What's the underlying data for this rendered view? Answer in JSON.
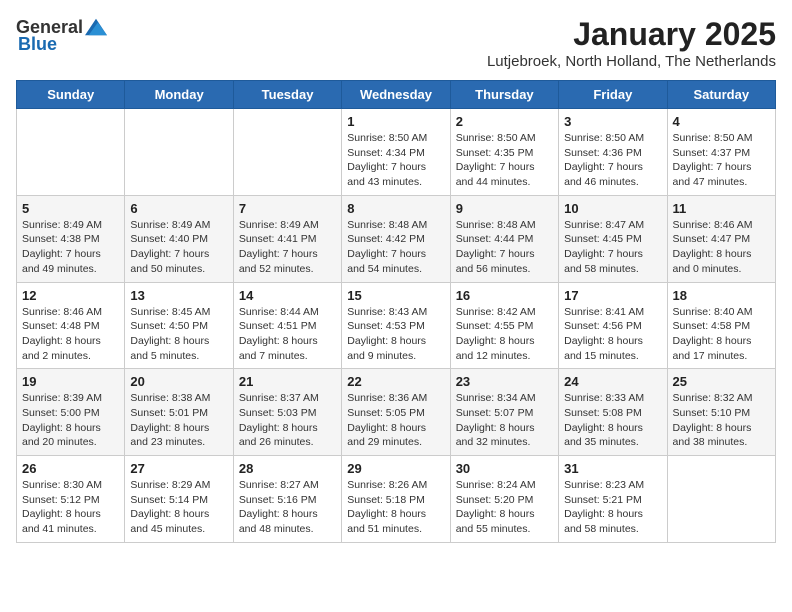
{
  "header": {
    "logo_general": "General",
    "logo_blue": "Blue",
    "month": "January 2025",
    "location": "Lutjebroek, North Holland, The Netherlands"
  },
  "weekdays": [
    "Sunday",
    "Monday",
    "Tuesday",
    "Wednesday",
    "Thursday",
    "Friday",
    "Saturday"
  ],
  "weeks": [
    [
      {
        "day": "",
        "sunrise": "",
        "sunset": "",
        "daylight": ""
      },
      {
        "day": "",
        "sunrise": "",
        "sunset": "",
        "daylight": ""
      },
      {
        "day": "",
        "sunrise": "",
        "sunset": "",
        "daylight": ""
      },
      {
        "day": "1",
        "sunrise": "Sunrise: 8:50 AM",
        "sunset": "Sunset: 4:34 PM",
        "daylight": "Daylight: 7 hours and 43 minutes."
      },
      {
        "day": "2",
        "sunrise": "Sunrise: 8:50 AM",
        "sunset": "Sunset: 4:35 PM",
        "daylight": "Daylight: 7 hours and 44 minutes."
      },
      {
        "day": "3",
        "sunrise": "Sunrise: 8:50 AM",
        "sunset": "Sunset: 4:36 PM",
        "daylight": "Daylight: 7 hours and 46 minutes."
      },
      {
        "day": "4",
        "sunrise": "Sunrise: 8:50 AM",
        "sunset": "Sunset: 4:37 PM",
        "daylight": "Daylight: 7 hours and 47 minutes."
      }
    ],
    [
      {
        "day": "5",
        "sunrise": "Sunrise: 8:49 AM",
        "sunset": "Sunset: 4:38 PM",
        "daylight": "Daylight: 7 hours and 49 minutes."
      },
      {
        "day": "6",
        "sunrise": "Sunrise: 8:49 AM",
        "sunset": "Sunset: 4:40 PM",
        "daylight": "Daylight: 7 hours and 50 minutes."
      },
      {
        "day": "7",
        "sunrise": "Sunrise: 8:49 AM",
        "sunset": "Sunset: 4:41 PM",
        "daylight": "Daylight: 7 hours and 52 minutes."
      },
      {
        "day": "8",
        "sunrise": "Sunrise: 8:48 AM",
        "sunset": "Sunset: 4:42 PM",
        "daylight": "Daylight: 7 hours and 54 minutes."
      },
      {
        "day": "9",
        "sunrise": "Sunrise: 8:48 AM",
        "sunset": "Sunset: 4:44 PM",
        "daylight": "Daylight: 7 hours and 56 minutes."
      },
      {
        "day": "10",
        "sunrise": "Sunrise: 8:47 AM",
        "sunset": "Sunset: 4:45 PM",
        "daylight": "Daylight: 7 hours and 58 minutes."
      },
      {
        "day": "11",
        "sunrise": "Sunrise: 8:46 AM",
        "sunset": "Sunset: 4:47 PM",
        "daylight": "Daylight: 8 hours and 0 minutes."
      }
    ],
    [
      {
        "day": "12",
        "sunrise": "Sunrise: 8:46 AM",
        "sunset": "Sunset: 4:48 PM",
        "daylight": "Daylight: 8 hours and 2 minutes."
      },
      {
        "day": "13",
        "sunrise": "Sunrise: 8:45 AM",
        "sunset": "Sunset: 4:50 PM",
        "daylight": "Daylight: 8 hours and 5 minutes."
      },
      {
        "day": "14",
        "sunrise": "Sunrise: 8:44 AM",
        "sunset": "Sunset: 4:51 PM",
        "daylight": "Daylight: 8 hours and 7 minutes."
      },
      {
        "day": "15",
        "sunrise": "Sunrise: 8:43 AM",
        "sunset": "Sunset: 4:53 PM",
        "daylight": "Daylight: 8 hours and 9 minutes."
      },
      {
        "day": "16",
        "sunrise": "Sunrise: 8:42 AM",
        "sunset": "Sunset: 4:55 PM",
        "daylight": "Daylight: 8 hours and 12 minutes."
      },
      {
        "day": "17",
        "sunrise": "Sunrise: 8:41 AM",
        "sunset": "Sunset: 4:56 PM",
        "daylight": "Daylight: 8 hours and 15 minutes."
      },
      {
        "day": "18",
        "sunrise": "Sunrise: 8:40 AM",
        "sunset": "Sunset: 4:58 PM",
        "daylight": "Daylight: 8 hours and 17 minutes."
      }
    ],
    [
      {
        "day": "19",
        "sunrise": "Sunrise: 8:39 AM",
        "sunset": "Sunset: 5:00 PM",
        "daylight": "Daylight: 8 hours and 20 minutes."
      },
      {
        "day": "20",
        "sunrise": "Sunrise: 8:38 AM",
        "sunset": "Sunset: 5:01 PM",
        "daylight": "Daylight: 8 hours and 23 minutes."
      },
      {
        "day": "21",
        "sunrise": "Sunrise: 8:37 AM",
        "sunset": "Sunset: 5:03 PM",
        "daylight": "Daylight: 8 hours and 26 minutes."
      },
      {
        "day": "22",
        "sunrise": "Sunrise: 8:36 AM",
        "sunset": "Sunset: 5:05 PM",
        "daylight": "Daylight: 8 hours and 29 minutes."
      },
      {
        "day": "23",
        "sunrise": "Sunrise: 8:34 AM",
        "sunset": "Sunset: 5:07 PM",
        "daylight": "Daylight: 8 hours and 32 minutes."
      },
      {
        "day": "24",
        "sunrise": "Sunrise: 8:33 AM",
        "sunset": "Sunset: 5:08 PM",
        "daylight": "Daylight: 8 hours and 35 minutes."
      },
      {
        "day": "25",
        "sunrise": "Sunrise: 8:32 AM",
        "sunset": "Sunset: 5:10 PM",
        "daylight": "Daylight: 8 hours and 38 minutes."
      }
    ],
    [
      {
        "day": "26",
        "sunrise": "Sunrise: 8:30 AM",
        "sunset": "Sunset: 5:12 PM",
        "daylight": "Daylight: 8 hours and 41 minutes."
      },
      {
        "day": "27",
        "sunrise": "Sunrise: 8:29 AM",
        "sunset": "Sunset: 5:14 PM",
        "daylight": "Daylight: 8 hours and 45 minutes."
      },
      {
        "day": "28",
        "sunrise": "Sunrise: 8:27 AM",
        "sunset": "Sunset: 5:16 PM",
        "daylight": "Daylight: 8 hours and 48 minutes."
      },
      {
        "day": "29",
        "sunrise": "Sunrise: 8:26 AM",
        "sunset": "Sunset: 5:18 PM",
        "daylight": "Daylight: 8 hours and 51 minutes."
      },
      {
        "day": "30",
        "sunrise": "Sunrise: 8:24 AM",
        "sunset": "Sunset: 5:20 PM",
        "daylight": "Daylight: 8 hours and 55 minutes."
      },
      {
        "day": "31",
        "sunrise": "Sunrise: 8:23 AM",
        "sunset": "Sunset: 5:21 PM",
        "daylight": "Daylight: 8 hours and 58 minutes."
      },
      {
        "day": "",
        "sunrise": "",
        "sunset": "",
        "daylight": ""
      }
    ]
  ]
}
